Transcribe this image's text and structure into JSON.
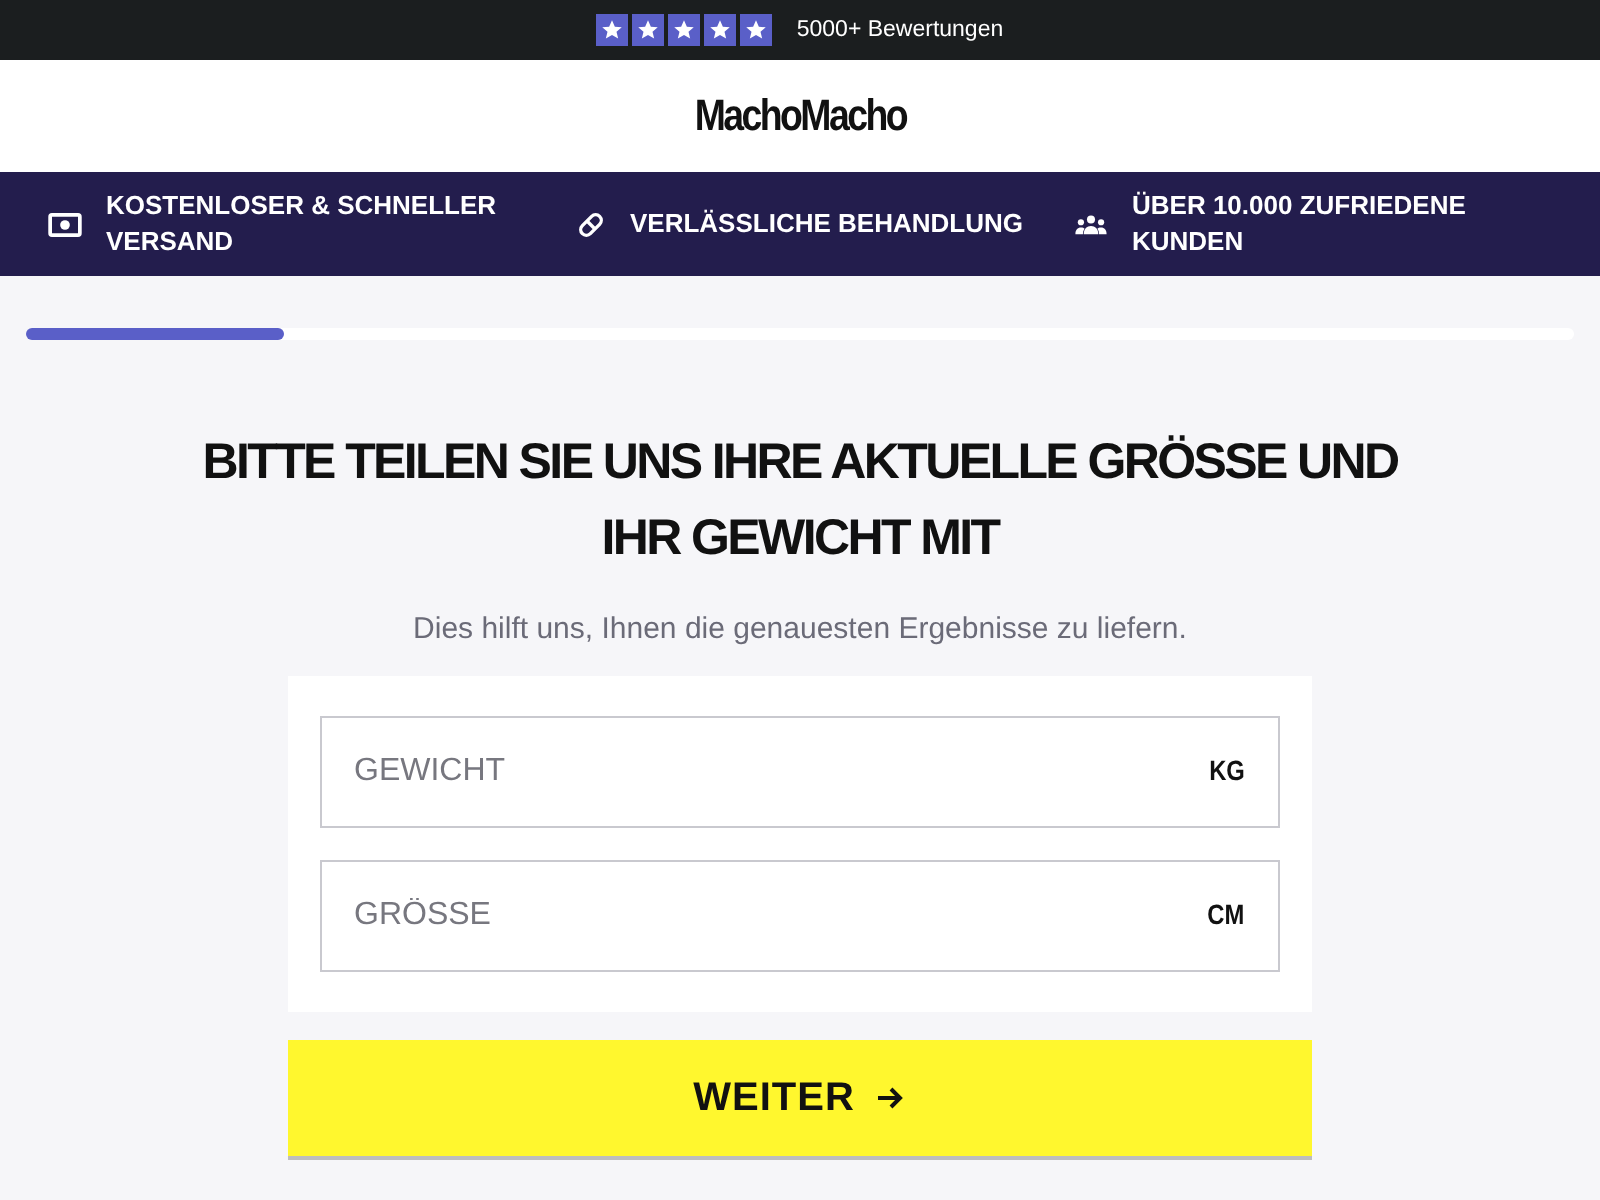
{
  "top_bar": {
    "stars": 5,
    "reviews": "5000+ Bewertungen"
  },
  "logo": "MachoMacho",
  "features": [
    {
      "kind": "money",
      "label": "KOSTENLOSER & SCHNELLER VERSAND"
    },
    {
      "kind": "pill",
      "label": "VERLÄSSLICHE BEHANDLUNG"
    },
    {
      "kind": "people",
      "label": "ÜBER 10.000 ZUFRIEDENE KUNDEN"
    }
  ],
  "progress": {
    "level": 0.167
  },
  "heading": "BITTE TEILEN SIE UNS IHRE AKTUELLE GRÖSSE UND IHR GEWICHT MIT",
  "subheading": "Dies hilft uns, Ihnen die genauesten Ergebnisse zu liefern.",
  "fields": [
    {
      "placeholder": "GEWICHT",
      "unit": "KG"
    },
    {
      "placeholder": "GRÖSSE",
      "unit": "CM"
    }
  ],
  "button": {
    "label": "WEITER"
  }
}
